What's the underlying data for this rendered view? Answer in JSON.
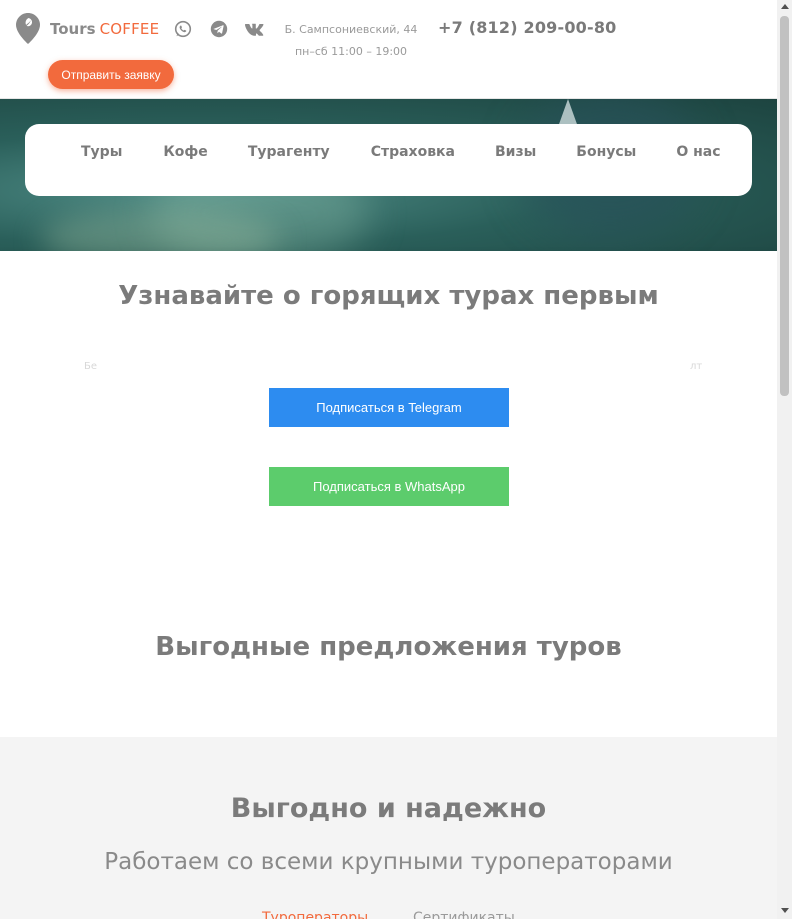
{
  "header": {
    "logo": {
      "word1": "Tours",
      "word2": "COFFEE",
      "pin_icon": "map-pin-icon"
    },
    "social": [
      {
        "name": "whatsapp",
        "icon": "whatsapp-icon"
      },
      {
        "name": "telegram",
        "icon": "telegram-icon"
      },
      {
        "name": "vk",
        "icon": "vk-icon"
      }
    ],
    "address_line1": "Б. Сампсониевский, 44",
    "address_line2": "пн–сб 11:00 – 19:00",
    "phone": "+7 (812) 209-00-80",
    "request_button": "Отправить заявку"
  },
  "nav": {
    "items": [
      "Туры",
      "Кофе",
      "Турагенту",
      "Страховка",
      "Визы",
      "Бонусы",
      "О нас"
    ]
  },
  "subscribe": {
    "title": "Узнавайте о горящих турах первым",
    "faint_left": "Бе",
    "faint_right": "лт",
    "telegram_button": "Подписаться в Telegram",
    "whatsapp_button": "Подписаться в WhatsApp"
  },
  "offers": {
    "title": "Выгодные предложения туров"
  },
  "reliable": {
    "title": "Выгодно и надежно",
    "subtitle": "Работаем со всеми крупными туроператорами",
    "tabs": [
      "Туроператоры",
      "Сертификаты"
    ]
  },
  "colors": {
    "accent": "#f26a3d",
    "telegram": "#2d8cf0",
    "whatsapp": "#5ccc6c"
  }
}
